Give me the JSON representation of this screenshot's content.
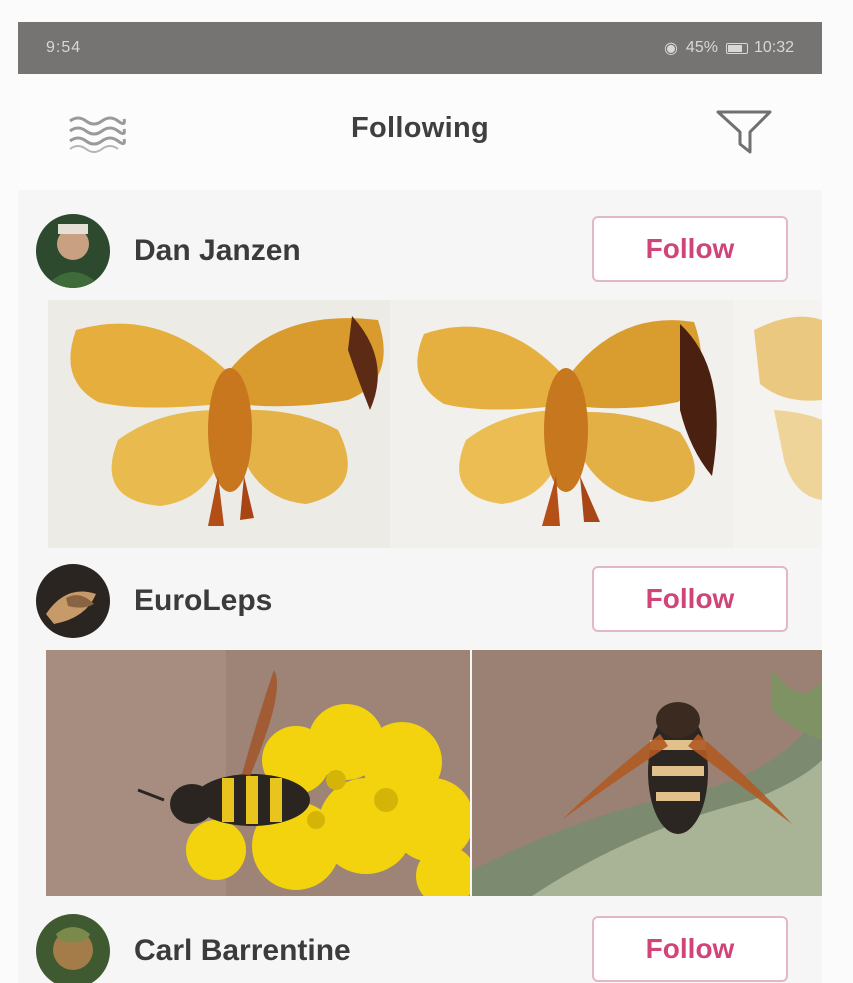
{
  "status_bar": {
    "left_text": "9:54",
    "right_text": "45%",
    "time": "10:32"
  },
  "header": {
    "title": "Following",
    "menu_icon": "wave-menu-icon",
    "filter_icon": "filter-funnel-icon"
  },
  "feed": {
    "users": [
      {
        "name": "Dan Janzen",
        "follow_label": "Follow",
        "photos": [
          "yellow-moth-specimen",
          "yellow-moth-specimen",
          "yellow-moth-specimen-partial"
        ]
      },
      {
        "name": "EuroLeps",
        "follow_label": "Follow",
        "photos": [
          "wasp-on-yellow-flower",
          "wasp-on-plant"
        ]
      },
      {
        "name": "Carl Barrentine",
        "follow_label": "Follow",
        "photos": []
      }
    ]
  },
  "colors": {
    "accent": "#d0447a",
    "status_bar": "#767472",
    "text": "#3b3b3b"
  }
}
